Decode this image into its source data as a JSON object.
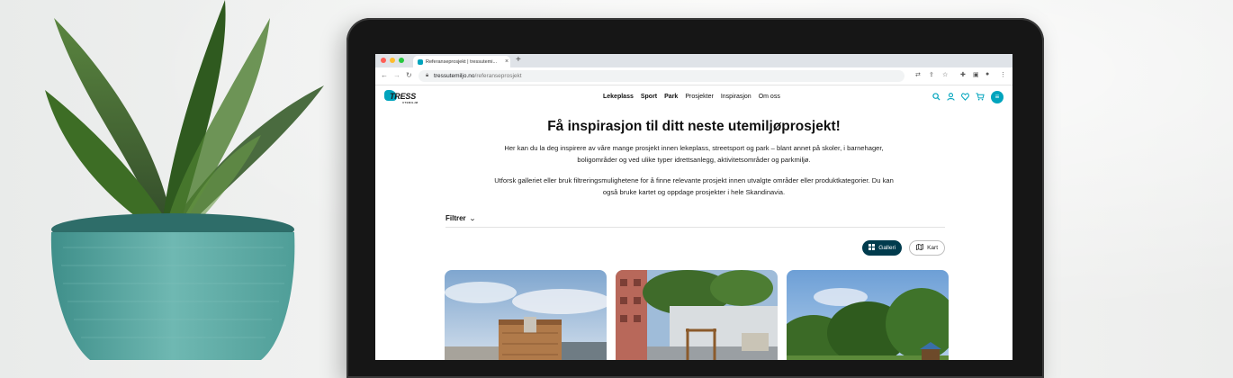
{
  "browser": {
    "tab_title": "Referanseprosjekt | tressutemi...",
    "tab_close": "×",
    "new_tab": "+",
    "url_domain": "tressutemiljo.no",
    "url_path": "/referanseprosjekt"
  },
  "site": {
    "logo_text": "TRESS",
    "logo_sub": "UTEMILJØ",
    "nav": [
      "Lekeplass",
      "Sport",
      "Park",
      "Prosjekter",
      "Inspirasjon",
      "Om oss"
    ]
  },
  "page": {
    "title": "Få inspirasjon til ditt neste utemiljøprosjekt!",
    "intro_1": "Her kan du la deg inspirere av våre mange prosjekt innen lekeplass, streetsport og park – blant annet på skoler, i barnehager, boligområder og ved ulike typer idrettsanlegg, aktivitetsområder og parkmiljø.",
    "intro_2": "Utforsk galleriet eller bruk filtreringsmulighetene for å finne relevante prosjekt innen utvalgte områder eller produktkategorier. Du kan også bruke kartet og oppdage prosjekter i hele Skandinavia.",
    "filter_label": "Filtrer",
    "view_gallery": "Galleri",
    "view_map": "Kart"
  },
  "colors": {
    "brand": "#00a4bd",
    "dark_accent": "#003b4d"
  },
  "icons": [
    "search-icon",
    "user-icon",
    "heart-icon",
    "cart-icon",
    "menu-icon",
    "grid-icon",
    "map-icon",
    "chevron-down-icon"
  ]
}
